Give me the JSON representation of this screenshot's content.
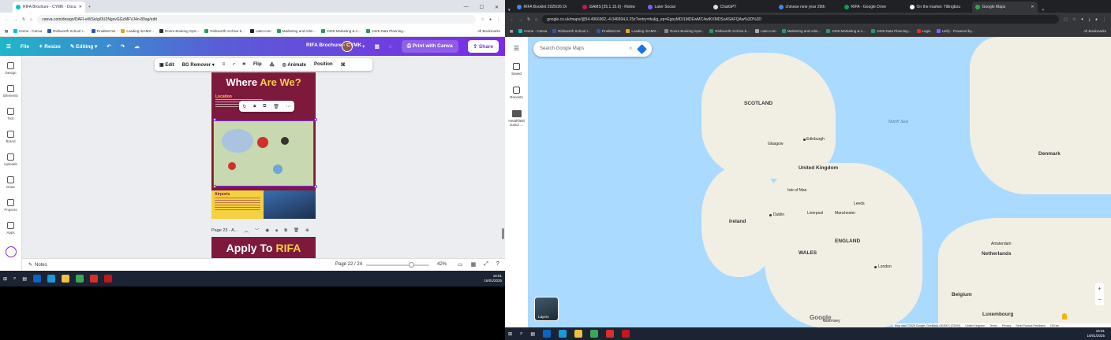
{
  "left_browser": {
    "tabs": [
      {
        "label": "RIFA Brochure - CYMK - Docu",
        "active": true
      }
    ],
    "url": "canva.com/design/DAFI-eWSe/g/0U2NgsvGGzMFVJ4n-89ag/edit",
    "bookmarks": [
      "Home - Canva",
      "Rishworth School I...",
      "FinaliteCms",
      "Loading iSAMS...",
      "Room Booking Syst...",
      "Rishworth Archive b...",
      "Later.com",
      "Marketing and Adm...",
      "2425 Marketing & A...",
      "2425 Data Planning..."
    ],
    "all_bookmarks": "All Bookmarks"
  },
  "canva": {
    "menu": {
      "file": "File",
      "resize": "Resize",
      "editing": "Editing"
    },
    "doc_title": "RIFA Brochure - CYMK",
    "print_label": "Print with Canva",
    "share_label": "Share",
    "sidebar": [
      "Design",
      "Elements",
      "Text",
      "Brand",
      "Uploads",
      "Draw",
      "Projects",
      "Apps"
    ],
    "context_toolbar": {
      "edit": "Edit",
      "bg_remover": "BG Remover",
      "flip": "Flip",
      "animate": "Animate",
      "position": "Position"
    },
    "page": {
      "heading_main": "Where",
      "heading_accent": "Are We?",
      "location_label": "Location",
      "airports_label": "Airports"
    },
    "page23_label": "Page 23 - A...",
    "page23_heading": "Apply To",
    "page23_accent": "RIFA",
    "bottom": {
      "notes": "Notes",
      "pager": "Page 22 / 24",
      "zoom": "42%"
    }
  },
  "left_taskbar": {
    "time": "16:01",
    "date": "16/01/2025"
  },
  "right_browser": {
    "tabs": [
      {
        "label": "RIFA Booklet 2025/26 Dr"
      },
      {
        "label": "iSAMS [25.1.15.9] - Rishw"
      },
      {
        "label": "Later Social"
      },
      {
        "label": "ChatGPT"
      },
      {
        "label": "chinese new year 29th"
      },
      {
        "label": "RIFA - Google Drive"
      },
      {
        "label": "On the market: Tillingbou"
      },
      {
        "label": "Google Maps",
        "active": true
      }
    ],
    "url": "google.co.uk/maps/@54.4966902,-4.046594,6.25z?entry=ttu&g_ep=EgoyMDI1MDEwMC4wIKXMDSoASAFQAw%3D%3D",
    "bookmarks": [
      "Home - Canva",
      "Rishworth School I...",
      "FinaliteCms",
      "Loading iSAMS...",
      "Room Booking Syst...",
      "Rishworth Archive b...",
      "Later.com",
      "Marketing and Adm...",
      "2425 Marketing & A...",
      "2425 Data Planning...",
      "Login",
      "Unify - Powered by..."
    ],
    "all_bookmarks": "All Bookmarks"
  },
  "maps": {
    "search_placeholder": "Search Google Maps",
    "sidebar": {
      "saved": "Saved",
      "recents": "Recents",
      "recent_place": "Heathfield Junior ..."
    },
    "labels": {
      "scotland": "SCOTLAND",
      "north_sea": "North Sea",
      "edinburgh": "Edinburgh",
      "glasgow": "Glasgow",
      "uk": "United Kingdom",
      "isle_of_man": "Isle of Man",
      "dublin": "Dublin",
      "ireland": "Ireland",
      "leeds": "Leeds",
      "liverpool": "Liverpool",
      "manchester": "Manchester",
      "england": "ENGLAND",
      "wales": "WALES",
      "london": "London",
      "denmark": "Denmark",
      "netherlands": "Netherlands",
      "belgium": "Belgium",
      "luxembourg": "Luxembourg",
      "guernsey": "Guernsey",
      "amsterdam": "Amsterdam"
    },
    "layers_label": "Layers",
    "footer": [
      "Map data ©2025 Google, GeoBasis-DE/BKG (©2009)",
      "United Kingdom",
      "Terms",
      "Privacy",
      "Send Product Feedback",
      "100 km"
    ],
    "google_logo": "Google"
  },
  "right_taskbar": {
    "time": "16:01",
    "date": "16/01/2025"
  }
}
